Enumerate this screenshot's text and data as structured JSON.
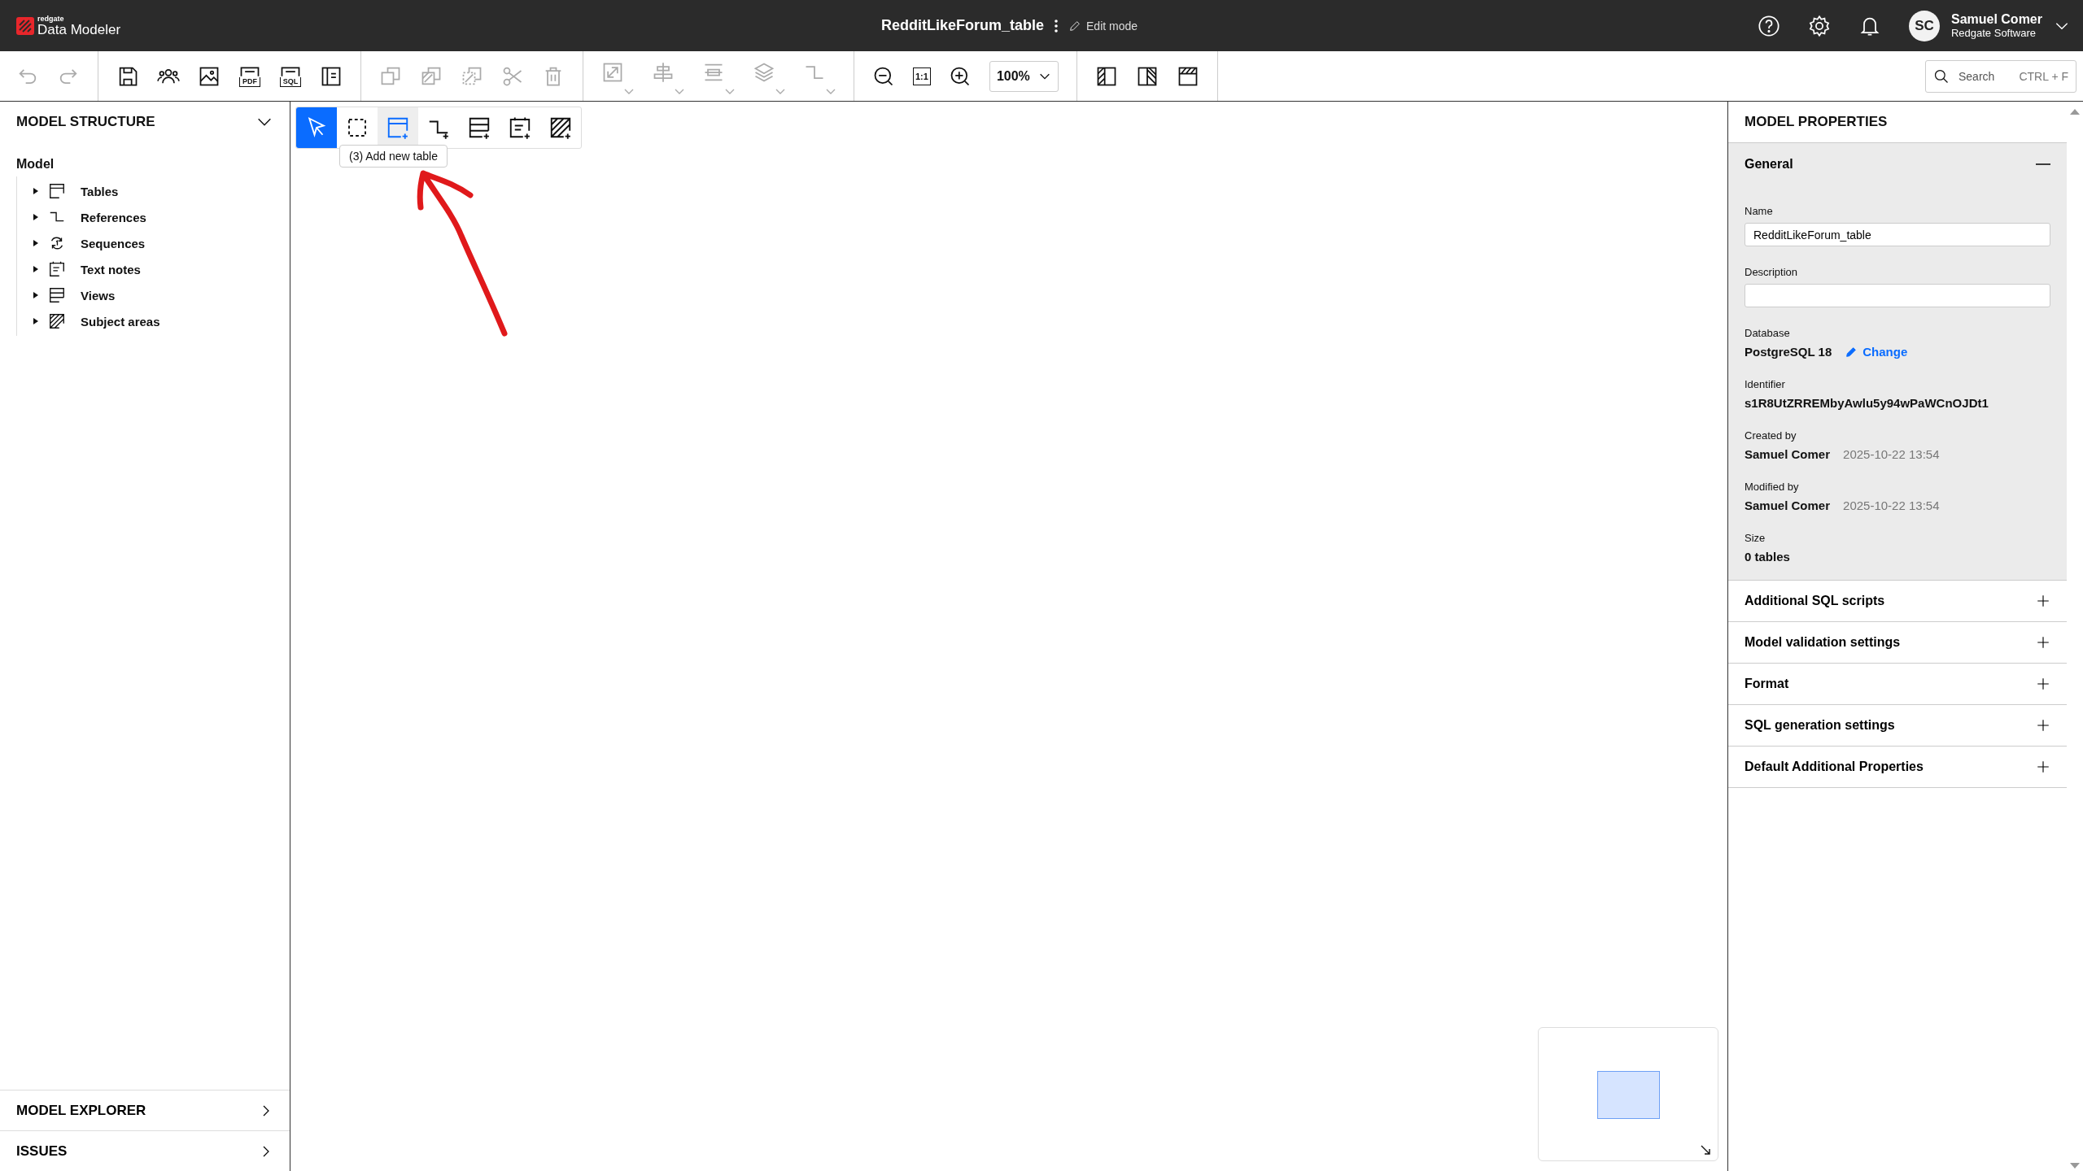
{
  "app": {
    "brand": "redgate",
    "product": "Data Modeler"
  },
  "document": {
    "title": "RedditLikeForum_table",
    "mode": "Edit mode"
  },
  "user": {
    "initials": "SC",
    "name": "Samuel Comer",
    "org": "Redgate Software"
  },
  "toolbar": {
    "groups": [
      [
        {
          "kind": "undo",
          "disabled": true
        },
        {
          "kind": "redo",
          "disabled": true
        }
      ],
      [
        {
          "kind": "save",
          "disabled": false
        },
        {
          "kind": "users",
          "disabled": false
        },
        {
          "kind": "image",
          "disabled": false
        },
        {
          "kind": "doc",
          "label": "PDF",
          "disabled": false
        },
        {
          "kind": "doc",
          "label": "SQL",
          "disabled": false
        },
        {
          "kind": "panel",
          "disabled": false
        }
      ],
      [
        {
          "kind": "copy",
          "disabled": true
        },
        {
          "kind": "duplicate",
          "disabled": true
        },
        {
          "kind": "paste",
          "disabled": true
        },
        {
          "kind": "cut",
          "disabled": true
        },
        {
          "kind": "delete",
          "disabled": true
        }
      ],
      [
        {
          "kind": "resize",
          "disabled": true,
          "dropdown": true
        },
        {
          "kind": "align",
          "disabled": true,
          "dropdown": true
        },
        {
          "kind": "distribute",
          "disabled": true,
          "dropdown": true
        },
        {
          "kind": "layers",
          "disabled": true,
          "dropdown": true
        },
        {
          "kind": "connector",
          "disabled": true,
          "dropdown": true
        }
      ],
      [
        {
          "kind": "zoom-out",
          "disabled": false
        },
        {
          "kind": "fit",
          "label": "1:1",
          "disabled": false
        },
        {
          "kind": "zoom-in",
          "disabled": false
        },
        {
          "kind": "select",
          "label": "100%",
          "disabled": false
        }
      ],
      [
        {
          "kind": "layout-left",
          "disabled": false
        },
        {
          "kind": "layout-right",
          "disabled": false
        },
        {
          "kind": "layout-top",
          "disabled": false
        }
      ]
    ],
    "search": {
      "placeholder": "Search",
      "shortcut": "CTRL + F"
    }
  },
  "structure": {
    "title": "MODEL STRUCTURE",
    "root": "Model",
    "items": [
      {
        "kind": "table",
        "label": "Tables",
        "expanded": false
      },
      {
        "kind": "reference",
        "label": "References",
        "expanded": false
      },
      {
        "kind": "sequence",
        "label": "Sequences",
        "expanded": false
      },
      {
        "kind": "note",
        "label": "Text notes",
        "expanded": false
      },
      {
        "kind": "view",
        "label": "Views",
        "expanded": false
      },
      {
        "kind": "area",
        "label": "Subject areas",
        "expanded": false
      }
    ]
  },
  "bottom_panels": [
    {
      "title": "MODEL EXPLORER"
    },
    {
      "title": "ISSUES"
    }
  ],
  "palette": {
    "items": [
      {
        "kind": "pointer",
        "selected": true,
        "highlighted": false
      },
      {
        "kind": "marquee",
        "selected": false,
        "highlighted": false
      },
      {
        "kind": "table",
        "selected": false,
        "highlighted": true
      },
      {
        "kind": "reference",
        "selected": false,
        "highlighted": false
      },
      {
        "kind": "view",
        "selected": false,
        "highlighted": false
      },
      {
        "kind": "note",
        "selected": false,
        "highlighted": false
      },
      {
        "kind": "area",
        "selected": false,
        "highlighted": false
      }
    ],
    "tooltip": "(3) Add new table"
  },
  "properties": {
    "title": "MODEL PROPERTIES",
    "general": {
      "title": "General",
      "expanded": true,
      "fields": [
        {
          "kind": "input",
          "label": "Name",
          "value": "RedditLikeForum_table"
        },
        {
          "kind": "input",
          "label": "Description"
        },
        {
          "kind": "link",
          "label": "Database",
          "value": "PostgreSQL 18",
          "link": "Change"
        },
        {
          "kind": "value",
          "label": "Identifier",
          "value": "s1R8UtZRREMbyAwlu5y94wPaWCnOJDt1"
        },
        {
          "kind": "person",
          "label": "Created by",
          "value": "Samuel Comer",
          "date": "2025-10-22 13:54"
        },
        {
          "kind": "person",
          "label": "Modified by",
          "value": "Samuel Comer",
          "date": "2025-10-22 13:54"
        },
        {
          "kind": "value",
          "label": "Size",
          "value": "0 tables"
        }
      ]
    },
    "sections": [
      {
        "title": "Additional SQL scripts",
        "expanded": false
      },
      {
        "title": "Model validation settings",
        "expanded": false
      },
      {
        "title": "Format",
        "expanded": false
      },
      {
        "title": "SQL generation settings",
        "expanded": false
      },
      {
        "title": "Default Additional Properties",
        "expanded": false
      }
    ]
  }
}
